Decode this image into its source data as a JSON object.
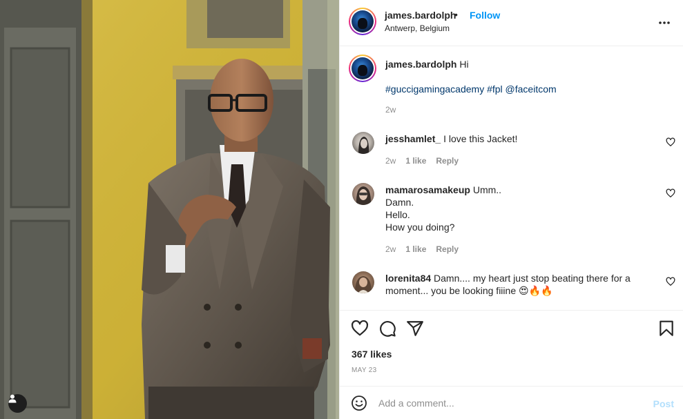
{
  "post": {
    "username": "james.bardolph",
    "separator": "•",
    "follow_label": "Follow",
    "location": "Antwerp, Belgium",
    "more_icon": "more-horizontal-icon"
  },
  "caption": {
    "username": "james.bardolph",
    "text": "Hi",
    "hashtags": "#guccigamingacademy #fpl @faceitcom",
    "time": "2w"
  },
  "comments": [
    {
      "username": "jesshamlet_",
      "lines": [
        "I love this Jacket!"
      ],
      "time": "2w",
      "likes": "1 like",
      "reply": "Reply"
    },
    {
      "username": "mamarosamakeup",
      "lines": [
        "Umm..",
        "Damn.",
        "Hello.",
        "How you doing?"
      ],
      "time": "2w",
      "likes": "1 like",
      "reply": "Reply"
    },
    {
      "username": "lorenita84",
      "lines": [
        "Damn.... my heart just stop beating there for a",
        "moment... you be looking fiiine 😍🔥🔥"
      ]
    }
  ],
  "actions": {
    "like_icon": "heart-icon",
    "comment_icon": "comment-icon",
    "share_icon": "send-icon",
    "save_icon": "bookmark-icon"
  },
  "likes": "367 likes",
  "date": "MAY 23",
  "comment_box": {
    "placeholder": "Add a comment...",
    "post_label": "Post",
    "emoji_icon": "emoji-icon"
  },
  "photo": {
    "tag_icon": "user-tag-icon"
  },
  "colors": {
    "accent": "#0095f6",
    "post_disabled": "#b2dffc",
    "hashtag": "#00376b",
    "muted": "#8e8e8e",
    "wall": "#d4b93a"
  }
}
